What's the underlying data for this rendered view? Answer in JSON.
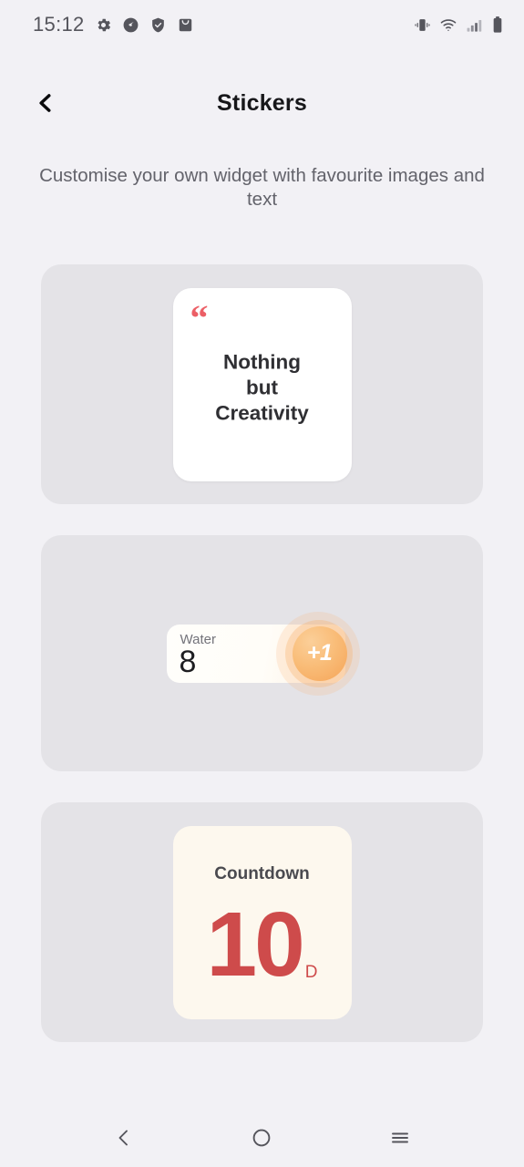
{
  "status_bar": {
    "time": "15:12",
    "left_icons": [
      "gear-icon",
      "speedometer-icon",
      "shield-check-icon",
      "inbox-icon"
    ],
    "right_icons": [
      "vibrate-icon",
      "wifi-icon",
      "cellular-signal-icon",
      "battery-icon"
    ]
  },
  "header": {
    "back_icon": "chevron-left-icon",
    "title": "Stickers"
  },
  "subtitle": "Customise your own widget with favourite images and text",
  "cards": [
    {
      "widget_type": "quote",
      "quote_mark": "“",
      "text": "Nothing but Creativity",
      "lines": [
        "Nothing",
        "but",
        "Creativity"
      ],
      "bg_color": "#ffffff",
      "accent_color": "#ec5f66"
    },
    {
      "widget_type": "water-counter",
      "label": "Water",
      "value": "8",
      "button_label": "+1",
      "bg_color": "#fffefb",
      "accent_color": "#f5a457"
    },
    {
      "widget_type": "countdown",
      "title": "Countdown",
      "value": "10",
      "unit": "D",
      "bg_color": "#fdf8ee",
      "accent_color": "#ce4b4b"
    }
  ],
  "nav_bar": {
    "back": "chevron-left-icon",
    "home": "circle-icon",
    "recents": "menu-icon"
  },
  "colors": {
    "page_bg": "#f2f1f5",
    "card_bg": "#e4e3e7",
    "title": "#17171a",
    "subtitle": "#63636b"
  }
}
